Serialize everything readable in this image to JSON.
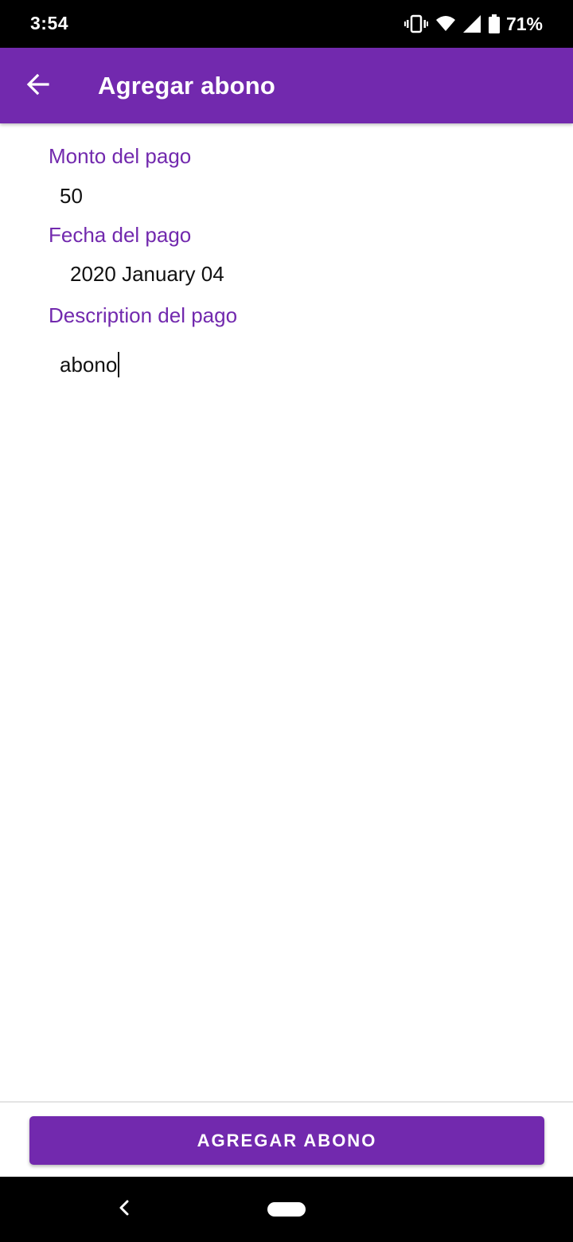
{
  "status_bar": {
    "time": "3:54",
    "battery_percent": "71%",
    "icons": [
      "vibrate-icon",
      "wifi-icon",
      "signal-icon",
      "battery-icon"
    ]
  },
  "app_bar": {
    "title": "Agregar abono",
    "back_icon": "arrow-back-icon"
  },
  "form": {
    "amount": {
      "label": "Monto del pago",
      "value": "50"
    },
    "date": {
      "label": "Fecha del pago",
      "value": "2020 January 04"
    },
    "description": {
      "label": "Description del pago",
      "value": "abono"
    }
  },
  "footer": {
    "submit_label": "AGREGAR ABONO"
  },
  "nav_bar": {
    "icons": [
      "nav-back-icon",
      "nav-home-pill"
    ]
  },
  "colors": {
    "primary": "#7229AE",
    "status_bar": "#000000"
  }
}
